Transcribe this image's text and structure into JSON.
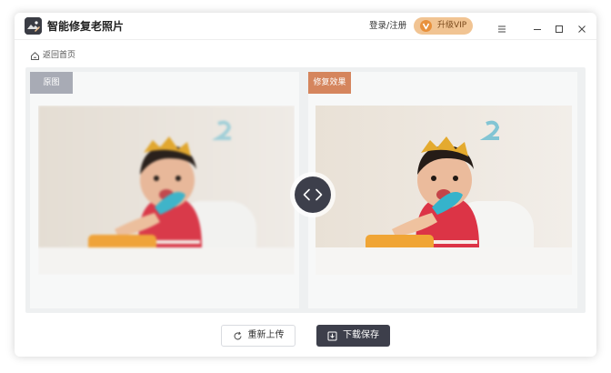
{
  "app": {
    "title": "智能修复老照片",
    "logo_icon": "photo-restore-logo-icon"
  },
  "header": {
    "login_label": "登录/注册",
    "vip_label": "升级VIP",
    "vip_icon": "vip-badge-icon",
    "window_controls": [
      "menu-icon",
      "minimize-icon",
      "maximize-icon",
      "close-icon"
    ]
  },
  "nav": {
    "back_label": "返回首页",
    "back_icon": "home-icon"
  },
  "compare": {
    "original_label": "原图",
    "restored_label": "修复效果",
    "handle_icon": "compare-arrows-icon"
  },
  "actions": {
    "reupload_label": "重新上传",
    "reupload_icon": "refresh-icon",
    "download_label": "下载保存",
    "download_icon": "download-icon"
  },
  "colors": {
    "dark_accent": "#3d3f4b",
    "vip_gold": "#f1c493",
    "original_tag": "#a8abb5",
    "restored_tag": "#d5855d"
  }
}
